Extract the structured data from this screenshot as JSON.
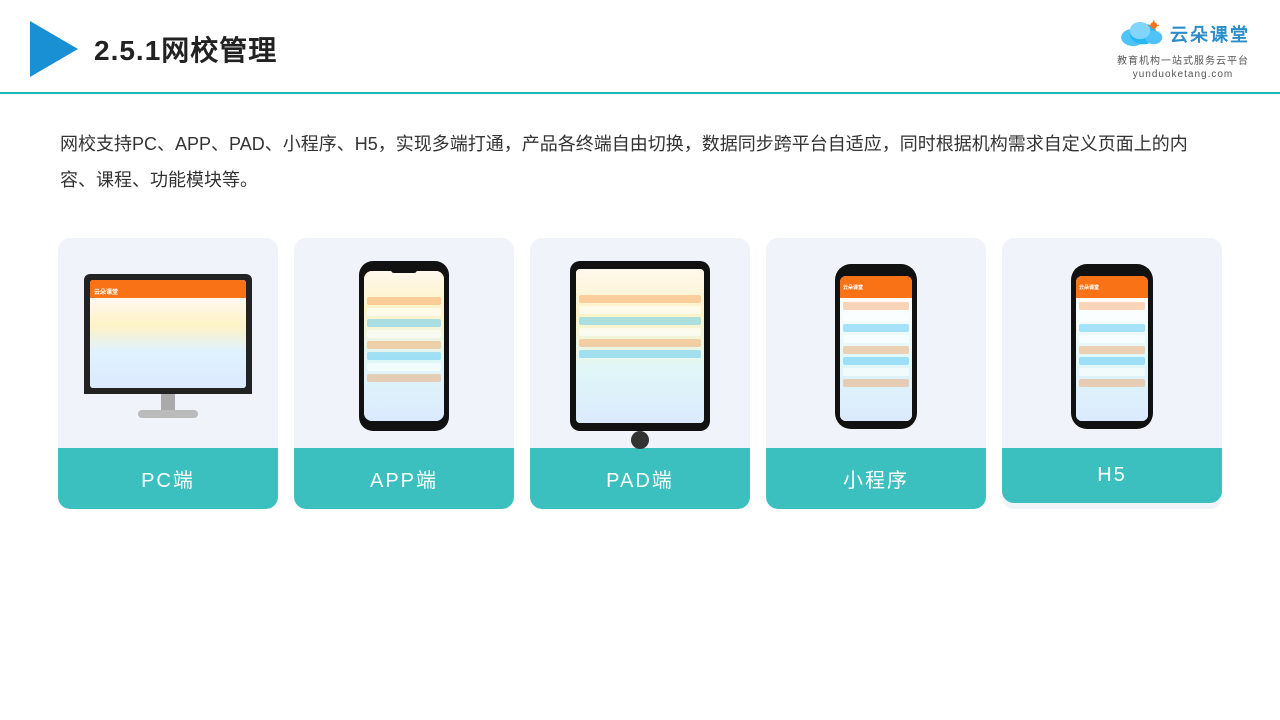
{
  "header": {
    "title": "2.5.1网校管理",
    "logo_main": "云朵课堂",
    "logo_url": "yunduoketang.com",
    "logo_sub": "教育机构一站式服务云平台"
  },
  "intro": {
    "text": "网校支持PC、APP、PAD、小程序、H5，实现多端打通，产品各终端自由切换，数据同步跨平台自适应，同时根据机构需求自定义页面上的内容、课程、功能模块等。"
  },
  "cards": [
    {
      "label": "PC端",
      "type": "pc"
    },
    {
      "label": "APP端",
      "type": "phone"
    },
    {
      "label": "PAD端",
      "type": "tablet"
    },
    {
      "label": "小程序",
      "type": "mini-phone"
    },
    {
      "label": "H5",
      "type": "mini-phone2"
    }
  ],
  "colors": {
    "teal": "#3cbfbf",
    "blue": "#1a90d4",
    "accent": "#f97316"
  }
}
